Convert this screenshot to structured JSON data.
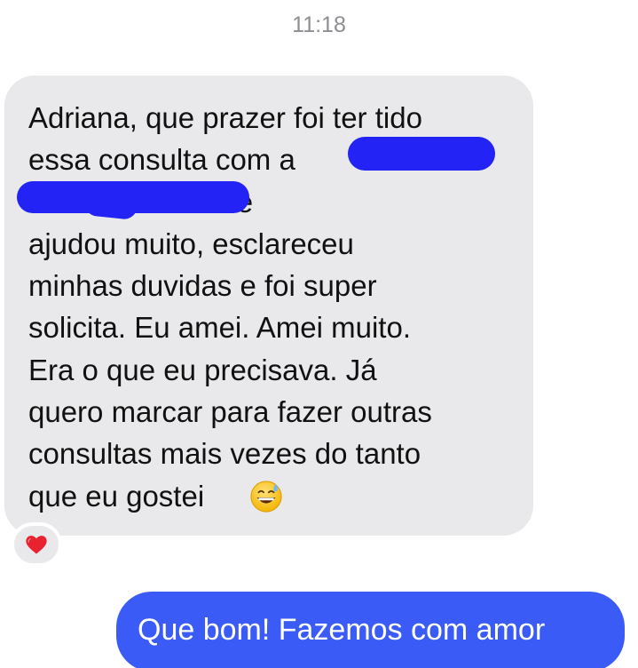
{
  "conversation": {
    "timestamp": "11:18",
    "incoming": {
      "text": "Adriana, que prazer foi ter tido\nessa consulta com a\n                                 Ela é incrível. Me\najudou muito, esclareceu\nminhas duvidas e foi super\nsolicita. Eu amei. Amei muito.\nEra o que eu precisava. Já\nquero marcar para fazer outras\nconsultas mais vezes do tanto\nque eu gostei",
      "emoji": "grinning-face-with-sweat-emoji",
      "redaction_color": "#2323f5",
      "reaction": "heart-icon"
    },
    "outgoing": {
      "text": "Que bom! Fazemos com amor"
    },
    "colors": {
      "incoming_bubble": "#e9e9eb",
      "outgoing_bubble": "#3a5bf5",
      "timestamp": "#8e8e93",
      "heart": "#e8232f"
    }
  }
}
